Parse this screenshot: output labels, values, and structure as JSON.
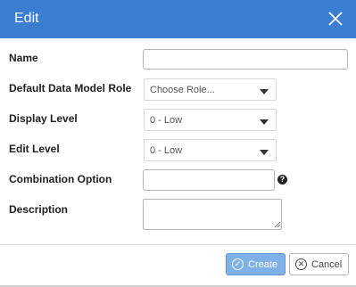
{
  "dialog": {
    "title": "Edit",
    "close_icon": "close-icon"
  },
  "form": {
    "name": {
      "label": "Name",
      "value": ""
    },
    "default_role": {
      "label": "Default Data Model Role",
      "selected": "Choose Role..."
    },
    "display_level": {
      "label": "Display Level",
      "selected": "0 - Low"
    },
    "edit_level": {
      "label": "Edit Level",
      "selected": "0 - Low"
    },
    "combination_option": {
      "label": "Combination Option",
      "value": "",
      "help_icon": "question-icon"
    },
    "description": {
      "label": "Description",
      "value": ""
    }
  },
  "footer": {
    "create_label": "Create",
    "create_icon": "check-circle-icon",
    "cancel_label": "Cancel",
    "cancel_icon": "x-circle-icon"
  },
  "colors": {
    "header": "#3a7ed1",
    "create_button": "#7fb1e6"
  }
}
